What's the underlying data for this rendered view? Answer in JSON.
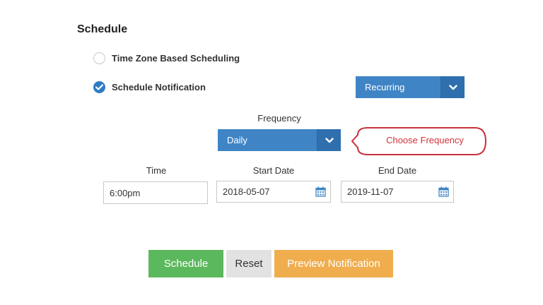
{
  "section": {
    "title": "Schedule"
  },
  "options": {
    "timezone": {
      "label": "Time Zone Based Scheduling",
      "selected": false
    },
    "notification": {
      "label": "Schedule Notification",
      "selected": true
    }
  },
  "recurrence": {
    "value": "Recurring"
  },
  "frequency": {
    "label": "Frequency",
    "value": "Daily"
  },
  "callout": {
    "text": "Choose Frequency"
  },
  "time": {
    "label": "Time",
    "value": "6:00pm"
  },
  "start_date": {
    "label": "Start Date",
    "value": "2018-05-07"
  },
  "end_date": {
    "label": "End Date",
    "value": "2019-11-07"
  },
  "buttons": {
    "schedule": "Schedule",
    "reset": "Reset",
    "preview": "Preview Notification"
  },
  "colors": {
    "primary_blue": "#3f85c6",
    "success_green": "#5cb85c",
    "warning_orange": "#f0ad4e",
    "callout_red": "#d1333a"
  }
}
